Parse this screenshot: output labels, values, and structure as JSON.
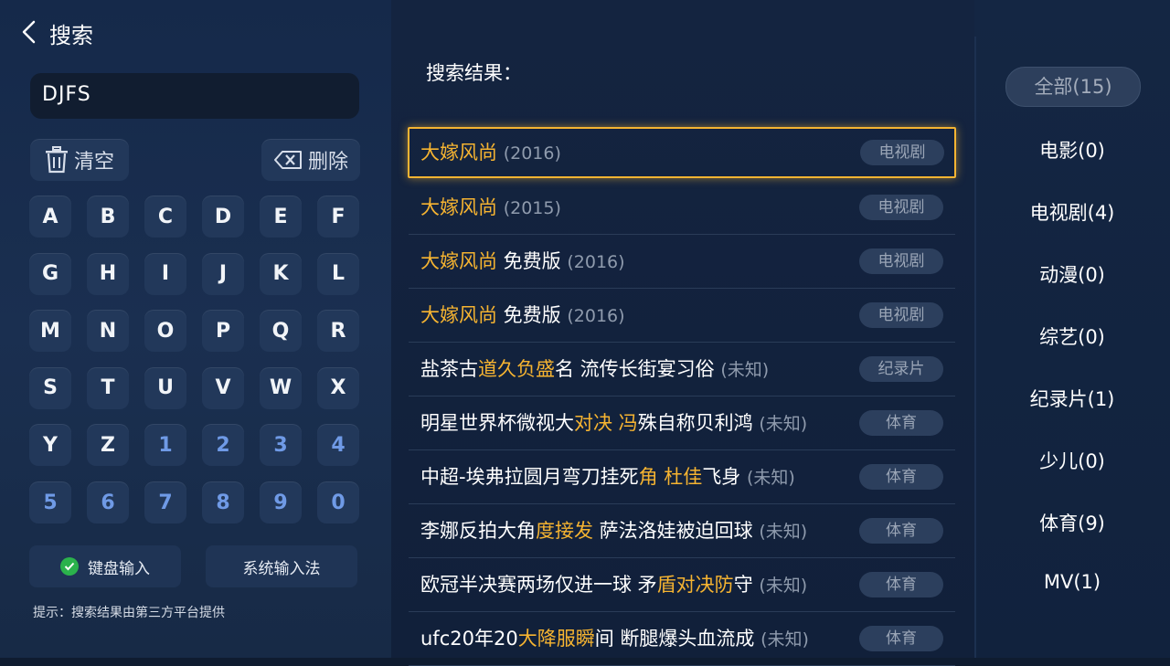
{
  "header": {
    "title": "搜索"
  },
  "search": {
    "query": "DJFS"
  },
  "actions": {
    "clear_label": "清空",
    "delete_label": "删除"
  },
  "keyboard": {
    "keys": [
      "A",
      "B",
      "C",
      "D",
      "E",
      "F",
      "G",
      "H",
      "I",
      "J",
      "K",
      "L",
      "M",
      "N",
      "O",
      "P",
      "Q",
      "R",
      "S",
      "T",
      "U",
      "V",
      "W",
      "X",
      "Y",
      "Z",
      "1",
      "2",
      "3",
      "4",
      "5",
      "6",
      "7",
      "8",
      "9",
      "0"
    ]
  },
  "input_modes": {
    "keyboard_label": "键盘输入",
    "system_label": "系统输入法"
  },
  "hint": "提示：搜索结果由第三方平台提供",
  "results": {
    "title": "搜索结果：",
    "items": [
      {
        "segments": [
          {
            "t": "大嫁风尚",
            "hl": true
          }
        ],
        "year": "(2016)",
        "tag": "电视剧"
      },
      {
        "segments": [
          {
            "t": "大嫁风尚",
            "hl": true
          }
        ],
        "year": "(2015)",
        "tag": "电视剧"
      },
      {
        "segments": [
          {
            "t": "大嫁风尚",
            "hl": true
          },
          {
            "t": " 免费版",
            "hl": false
          }
        ],
        "year": "(2016)",
        "tag": "电视剧"
      },
      {
        "segments": [
          {
            "t": "大嫁风尚",
            "hl": true
          },
          {
            "t": " 免费版",
            "hl": false
          }
        ],
        "year": "(2016)",
        "tag": "电视剧"
      },
      {
        "segments": [
          {
            "t": "盐茶古",
            "hl": false
          },
          {
            "t": "道久负盛",
            "hl": true
          },
          {
            "t": "名 流传长街宴习俗",
            "hl": false
          }
        ],
        "year": "(未知)",
        "tag": "纪录片"
      },
      {
        "segments": [
          {
            "t": "明星世界杯微视大",
            "hl": false
          },
          {
            "t": "对决 冯",
            "hl": true
          },
          {
            "t": "殊自称贝利鸿",
            "hl": false
          }
        ],
        "year": "(未知)",
        "tag": "体育"
      },
      {
        "segments": [
          {
            "t": "中超-埃弗拉圆月弯刀挂死",
            "hl": false
          },
          {
            "t": "角 杜佳",
            "hl": true
          },
          {
            "t": "飞身",
            "hl": false
          }
        ],
        "year": "(未知)",
        "tag": "体育"
      },
      {
        "segments": [
          {
            "t": "李娜反拍大角",
            "hl": false
          },
          {
            "t": "度接发",
            "hl": true
          },
          {
            "t": " 萨法洛娃被迫回球",
            "hl": false
          }
        ],
        "year": "(未知)",
        "tag": "体育"
      },
      {
        "segments": [
          {
            "t": "欧冠半决赛两场仅进一球 矛",
            "hl": false
          },
          {
            "t": "盾对决防",
            "hl": true
          },
          {
            "t": "守",
            "hl": false
          }
        ],
        "year": "(未知)",
        "tag": "体育"
      },
      {
        "segments": [
          {
            "t": "ufc20年20",
            "hl": false
          },
          {
            "t": "大降服瞬",
            "hl": true
          },
          {
            "t": "间 断腿爆头血流成",
            "hl": false
          }
        ],
        "year": "(未知)",
        "tag": "体育"
      }
    ]
  },
  "categories": {
    "all": "全部(15)",
    "items": [
      "电影(0)",
      "电视剧(4)",
      "动漫(0)",
      "综艺(0)",
      "纪录片(1)",
      "少儿(0)",
      "体育(9)",
      "MV(1)"
    ]
  },
  "colors": {
    "highlight": "#f6b431",
    "number_key": "#6f9ae6",
    "check": "#2bb24c"
  }
}
